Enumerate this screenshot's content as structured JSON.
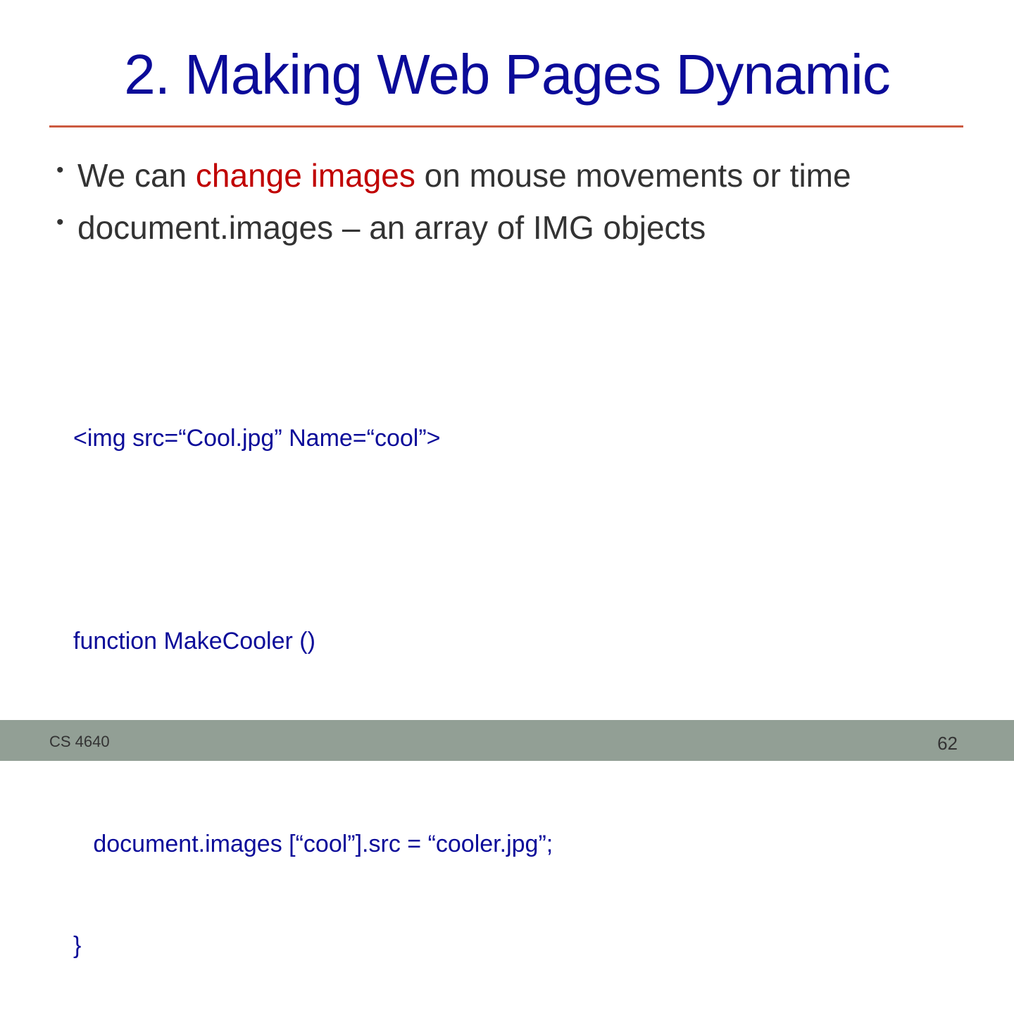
{
  "slide": {
    "title": "2. Making Web Pages Dynamic",
    "bullets": [
      {
        "marker": "•",
        "before": "We can ",
        "highlight": "change images",
        "after": " on mouse movements or time"
      },
      {
        "marker": "•",
        "text": "document.images – an array of IMG objects"
      }
    ],
    "code_lines": [
      "<img src=“Cool.jpg” Name=“cool”>",
      "",
      "function MakeCooler ()",
      "{",
      "   document.images [“cool”].src = “cooler.jpg”;",
      "}"
    ]
  },
  "footer": {
    "course": "CS 4640",
    "page_number": "62"
  },
  "colors": {
    "title": "#0b0b99",
    "rule": "#cc5a40",
    "body_text": "#333333",
    "highlight": "#c00000",
    "code": "#0b0b99",
    "footer_bg": "#929f95"
  }
}
